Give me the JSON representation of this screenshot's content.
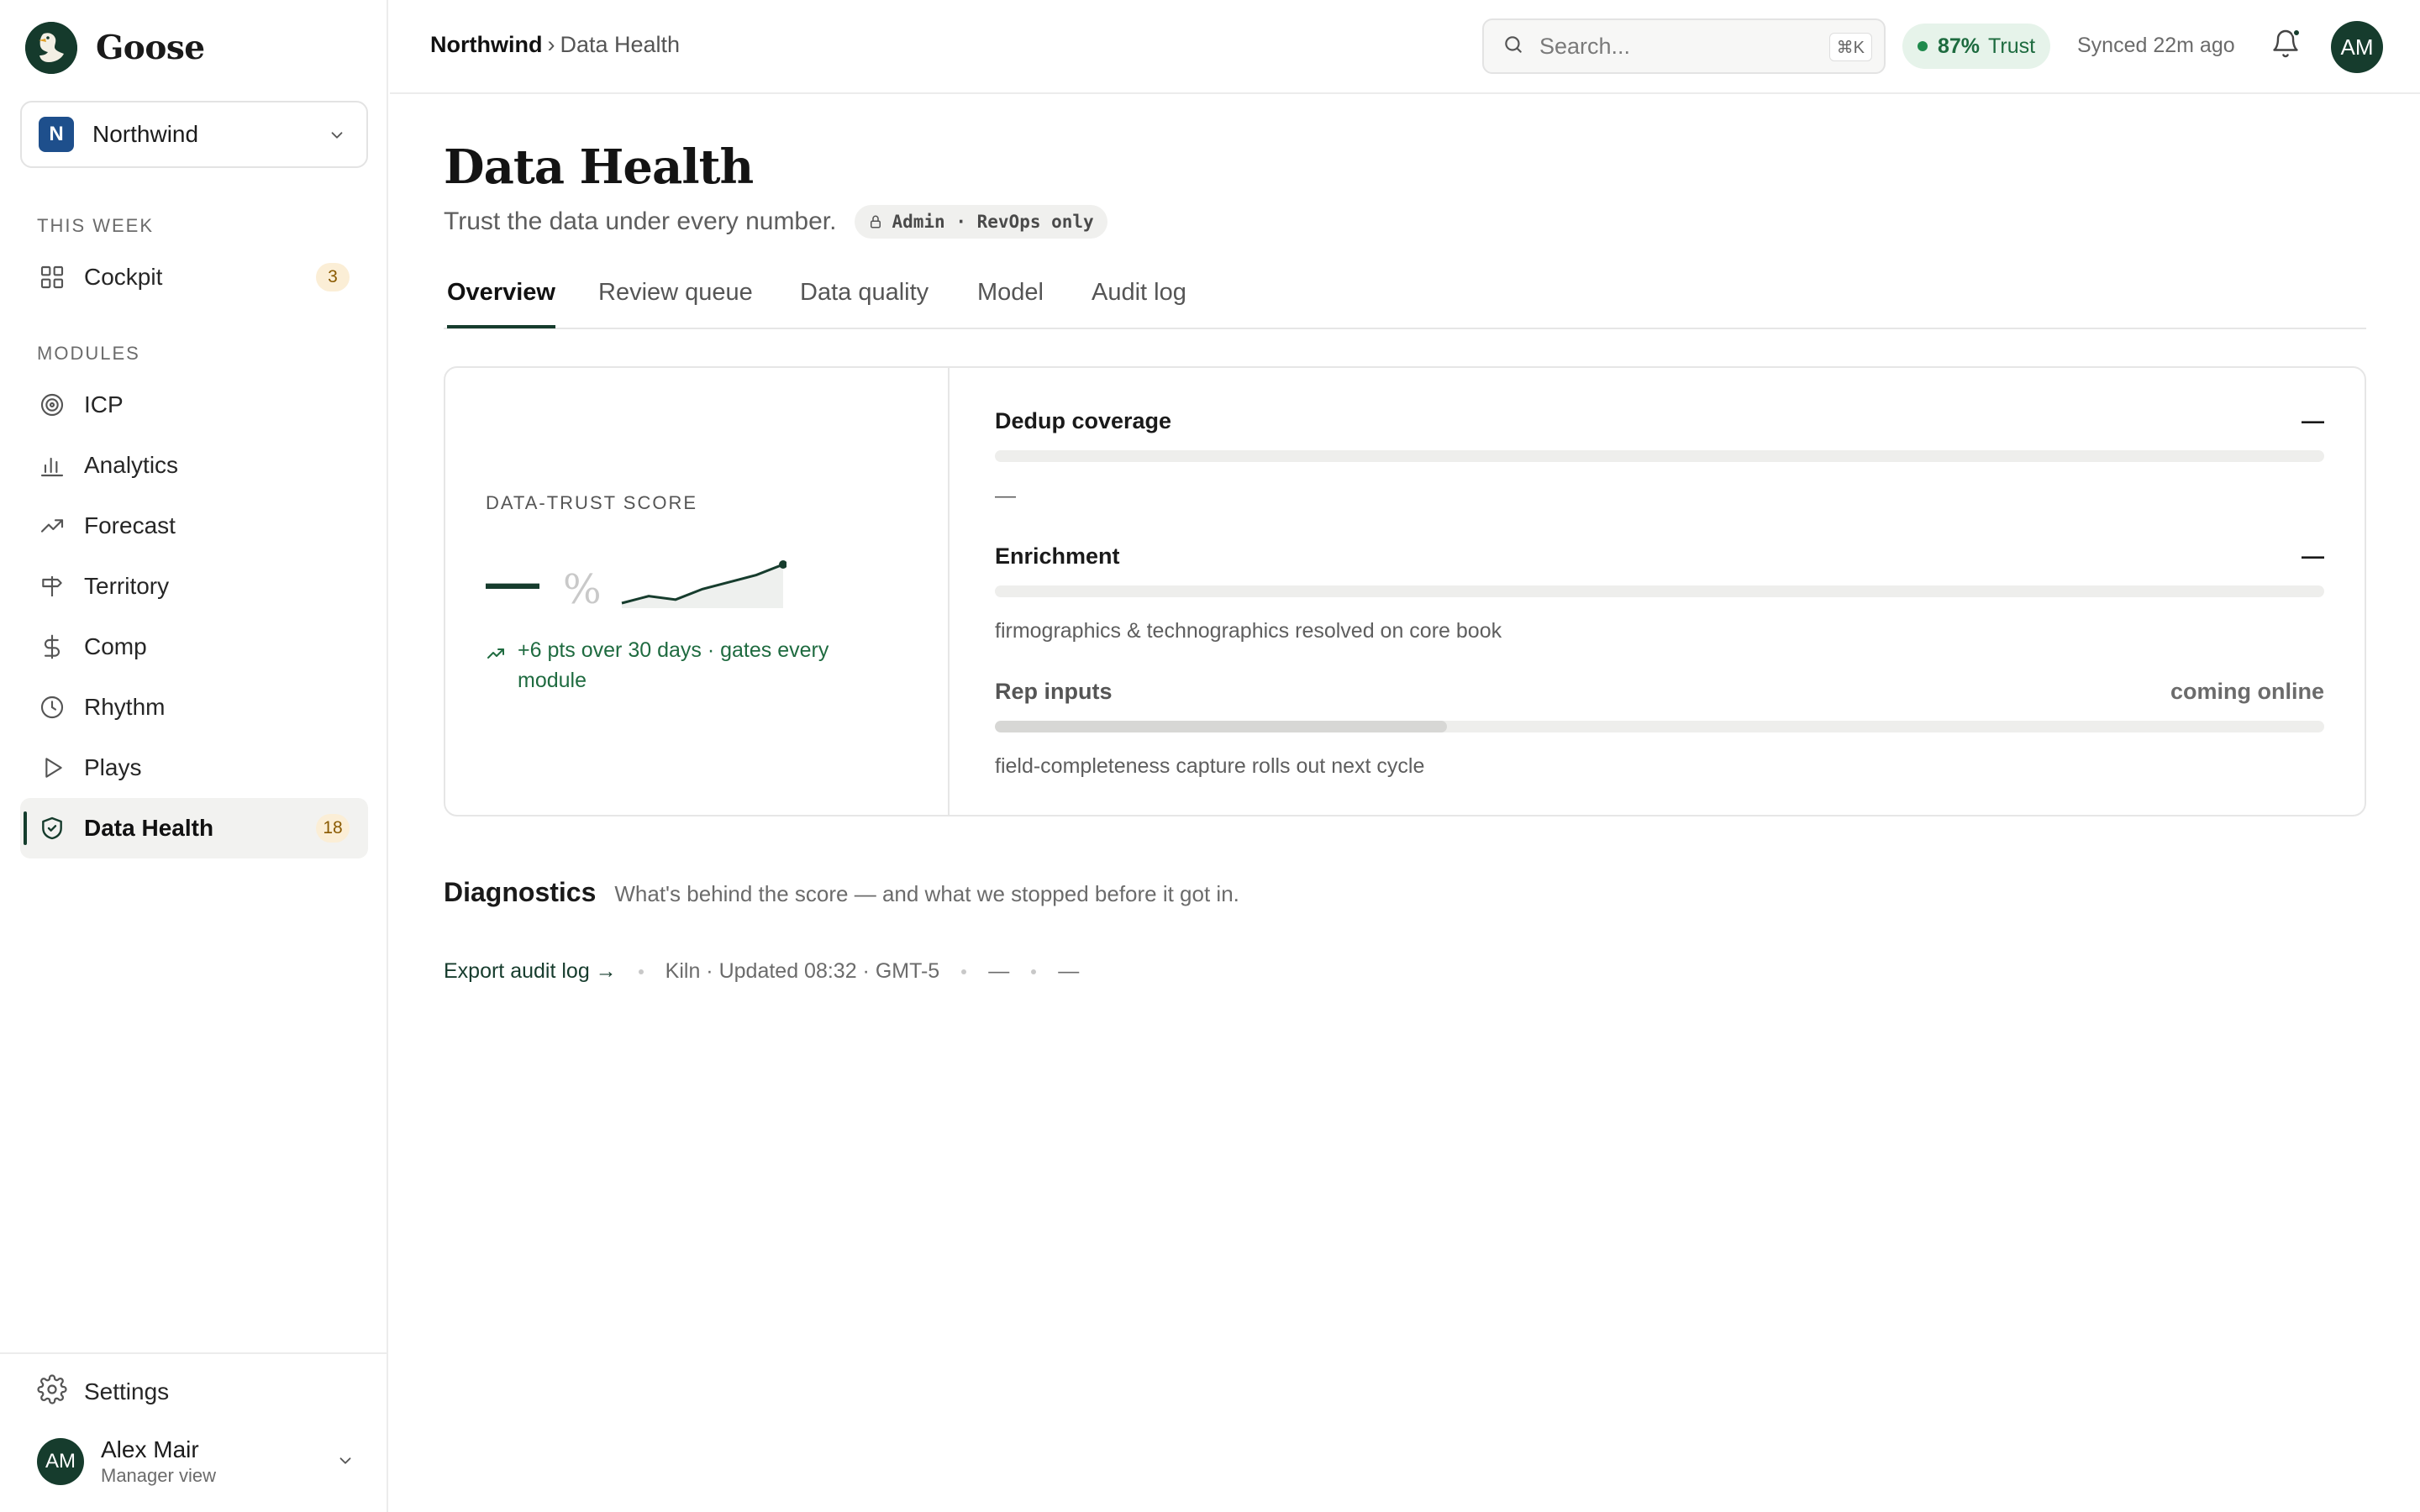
{
  "brand": {
    "name": "Goose",
    "logo_icon": "goose-logo-icon"
  },
  "workspace": {
    "initial": "N",
    "name": "Northwind",
    "badge_color": "#1e4f8c"
  },
  "sidebar": {
    "this_week_label": "THIS WEEK",
    "cockpit": {
      "label": "Cockpit",
      "count": "3",
      "icon": "grid-icon"
    },
    "modules_label": "MODULES",
    "items": [
      {
        "label": "ICP",
        "icon": "target-icon"
      },
      {
        "label": "Analytics",
        "icon": "bar-chart-icon"
      },
      {
        "label": "Forecast",
        "icon": "trend-up-icon"
      },
      {
        "label": "Territory",
        "icon": "signpost-icon"
      },
      {
        "label": "Comp",
        "icon": "dollar-icon"
      },
      {
        "label": "Rhythm",
        "icon": "clock-icon"
      },
      {
        "label": "Plays",
        "icon": "play-icon"
      },
      {
        "label": "Data Health",
        "icon": "shield-check-icon",
        "count": "18",
        "active": true
      }
    ],
    "settings_label": "Settings",
    "user": {
      "initials": "AM",
      "name": "Alex Mair",
      "role": "Manager view"
    }
  },
  "topbar": {
    "breadcrumb_root": "Northwind",
    "breadcrumb_sep": "›",
    "breadcrumb_current": "Data Health",
    "search_placeholder": "Search...",
    "search_shortcut": "⌘K",
    "trust_pct": "87%",
    "trust_label": "Trust",
    "synced": "Synced 22m ago",
    "avatar_initials": "AM"
  },
  "page": {
    "title": "Data Health",
    "subtitle": "Trust the data under every number.",
    "access_badge": "Admin · RevOps only"
  },
  "tabs": [
    "Overview",
    "Review queue",
    "Data quality",
    "Model",
    "Audit log"
  ],
  "score": {
    "label": "DATA-TRUST SCORE",
    "value": "—",
    "unit": "%",
    "trend_text": "+6 pts over 30 days · gates every module",
    "sparkline": [
      2,
      4,
      3,
      6,
      8,
      10,
      13
    ]
  },
  "metrics": [
    {
      "name": "Dedup coverage",
      "status": "—",
      "note": "—",
      "fill": 0
    },
    {
      "name": "Enrichment",
      "status": "—",
      "note": "firmographics & technographics resolved on core book",
      "fill": 0
    },
    {
      "name": "Rep inputs",
      "status": "coming online",
      "note": "field-completeness capture rolls out next cycle",
      "fill": 0.34
    }
  ],
  "diagnostics": {
    "title": "Diagnostics",
    "subtitle": "What's behind the score — and what we stopped before it got in."
  },
  "footer": {
    "export_link": "Export audit log →",
    "updated": "Kiln · Updated 08:32 · GMT-5",
    "value_a": "—",
    "value_b": "—"
  },
  "colors": {
    "brand_green": "#163c2d",
    "trust_green": "#1d6b3f",
    "badge_amber_bg": "#fbeed6"
  }
}
